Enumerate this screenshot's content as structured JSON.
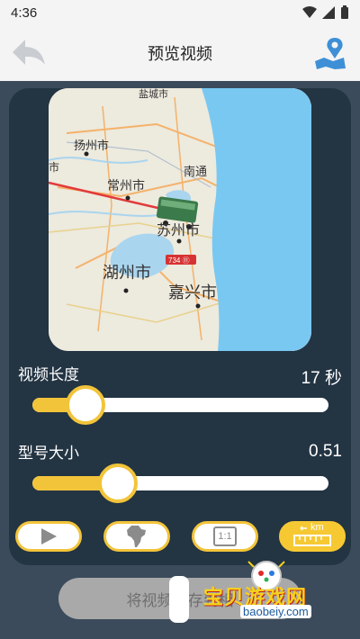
{
  "status_bar": {
    "time": "4:36"
  },
  "header": {
    "title": "预览视频",
    "back_icon": "back-arrow-icon",
    "map_icon": "map-pin-icon"
  },
  "map": {
    "labels": [
      "盐城市",
      "扬州市",
      "常州市",
      "南通",
      "苏州市",
      "湖州市",
      "嘉兴市",
      "市"
    ],
    "route_badge": "734 ⑪"
  },
  "video_length": {
    "label": "视频长度",
    "value": "17 秒",
    "level": 0.18
  },
  "model_size": {
    "label": "型号大小",
    "value": "0.51",
    "level": 0.29
  },
  "tools": [
    {
      "name": "play",
      "icon": "play-icon"
    },
    {
      "name": "continent",
      "icon": "africa-map-icon"
    },
    {
      "name": "ratio",
      "label": "1:1",
      "icon": "aspect-ratio-icon"
    },
    {
      "name": "scale",
      "label": "km",
      "icon": "ruler-km-icon",
      "active": true
    }
  ],
  "save_button": {
    "label": "将视频保存到相"
  },
  "watermark": {
    "text": "宝贝游戏网",
    "url": "baobeiy.com"
  },
  "colors": {
    "accent": "#f2c43a",
    "panel": "#233443",
    "background": "#3b4b5b"
  }
}
